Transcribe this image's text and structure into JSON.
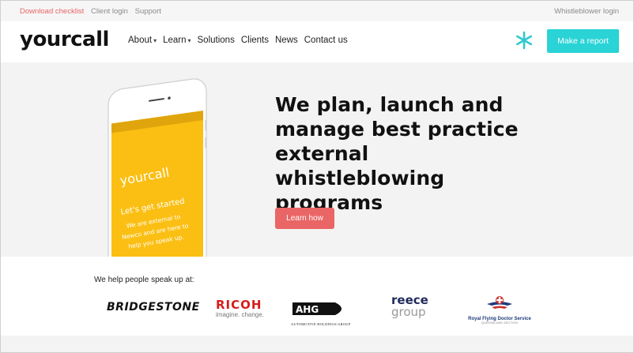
{
  "utility_bar": {
    "links": [
      "Download checklist",
      "Client login",
      "Support"
    ],
    "right_link": "Whistleblower login"
  },
  "brand": {
    "logo_text": "yourcall"
  },
  "nav": {
    "items": [
      {
        "label": "About",
        "caret": "▾"
      },
      {
        "label": "Learn",
        "caret": "▾"
      },
      {
        "label": "Solutions",
        "caret": ""
      },
      {
        "label": "Clients",
        "caret": ""
      },
      {
        "label": "News",
        "caret": ""
      },
      {
        "label": "Contact us",
        "caret": ""
      }
    ],
    "asterisk_icon": "asterisk-icon",
    "cta_label": "Make a report",
    "accent_color": "#29d3d6"
  },
  "hero": {
    "headline": "We plan, launch and manage best practice external whistleblowing programs",
    "button_label": "Learn how",
    "button_color": "#ea6565",
    "phone": {
      "app_name": "yourcall",
      "heading": "Let's get started",
      "line1": "We are external to",
      "line2": "Newco and are here to",
      "line3": "help you speak up.",
      "screen_color": "#fbbf13"
    }
  },
  "clients": {
    "label": "We help people speak up at:",
    "logos": {
      "bridgestone": "BRIDGESTONE",
      "ricoh": "RICOH",
      "ricoh_tagline": "imagine. change.",
      "ahg": "AHG",
      "ahg_sub": "AUTOMOTIVE HOLDINGS GROUP",
      "reece_1": "reece",
      "reece_2": "group",
      "rfds": "Royal Flying Doctor Service",
      "rfds_sub": "QUEENSLAND SECTION"
    }
  }
}
